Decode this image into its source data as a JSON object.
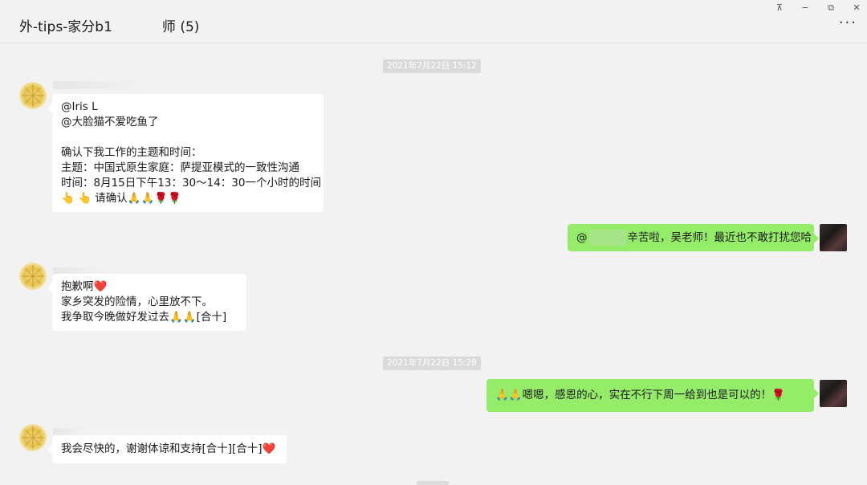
{
  "window": {
    "title": "外-tips-家分b1",
    "title_tail": "师 (5)",
    "pin_icon": "⊼",
    "minimize_icon": "−",
    "restore_icon": "⧉",
    "close_icon": "✕",
    "more_icon": "···"
  },
  "timestamps": [
    "2021年7月22日 15:12",
    "2021年7月22日 15:28"
  ],
  "messages": [
    {
      "lines": [
        "@Iris L",
        "@大脸猫不爱吃鱼了",
        "",
        "确认下我工作的主题和时间：",
        "主题：中国式原生家庭：萨提亚模式的一致性沟通",
        "时间：8月15日下午13：30～14：30一个小时的时间",
        "👆 👆 请确认🙏🙏🌹🌹"
      ]
    },
    {
      "prefix": "@",
      "text": "辛苦啦，吴老师！最近也不敢打扰您哈"
    },
    {
      "lines": [
        "抱歉啊❤️",
        "家乡突发的险情，心里放不下。",
        "我争取今晚做好发过去🙏🙏[合十]"
      ]
    },
    {
      "text": "🙏🙏嗯嗯，感恩的心，实在不行下周一给到也是可以的！🌹"
    },
    {
      "text": "我会尽快的，谢谢体谅和支持[合十][合十]❤️"
    }
  ],
  "colors": {
    "background": "#f2f2f2",
    "bubble_in": "#ffffff",
    "bubble_out": "#95ec69",
    "timestamp_bg": "#dadada"
  }
}
